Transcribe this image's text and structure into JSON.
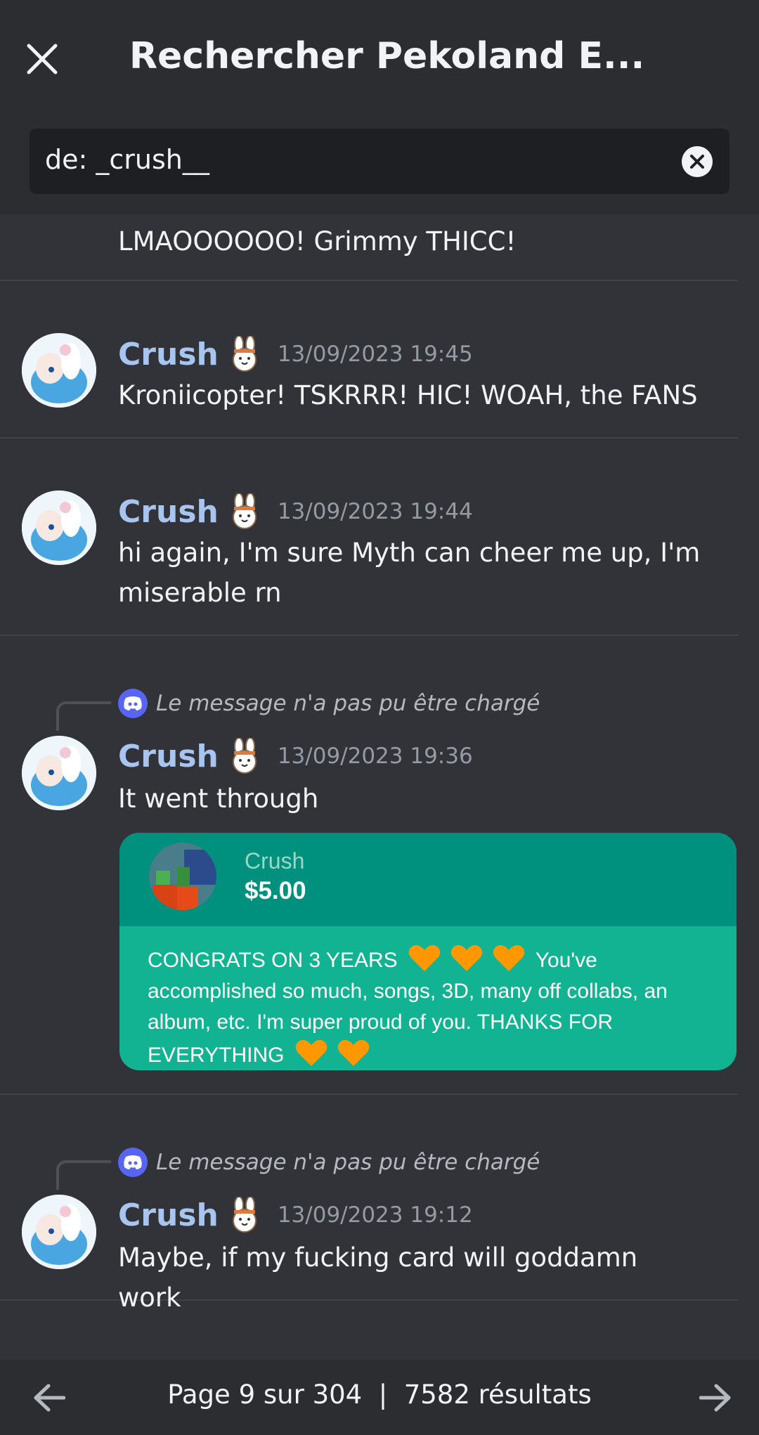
{
  "header": {
    "title": "Rechercher Pekoland E...",
    "search_value": "de: _crush__"
  },
  "results": [
    {
      "name": "",
      "time": "",
      "text": "LMAOOOOOO! Grimmy THICC!"
    },
    {
      "name": "Crush",
      "time": "13/09/2023 19:45",
      "text": "Kroniicopter! TSKRRR! HIC! WOAH, the FANS"
    },
    {
      "name": "Crush",
      "time": "13/09/2023 19:44",
      "text": "hi again, I'm sure Myth can cheer me up, I'm miserable rn"
    },
    {
      "name": "Crush",
      "time": "13/09/2023 19:36",
      "text": "It went through",
      "reply": "Le message n'a pas pu être chargé"
    },
    {
      "name": "Crush",
      "time": "13/09/2023 19:12",
      "text": "Maybe, if my fucking card will goddamn work",
      "reply": "Le message n'a pas pu être chargé"
    }
  ],
  "donation": {
    "name": "Crush",
    "amount": "$5.00",
    "message_part1": "CONGRATS ON 3 YEARS",
    "message_part2": "You've accomplished so much, songs, 3D, many off collabs, an album, etc. I'm super proud of you. THANKS FOR EVERYTHING"
  },
  "footer": {
    "pagination": "Page 9 sur 304  |  7582 résultats"
  },
  "colors": {
    "background": "#313338",
    "header": "#2b2d31",
    "username": "#a8c5f0",
    "donation_top": "#00917e",
    "donation_body": "#12b393",
    "discord_blurple": "#5865f2"
  },
  "icons": [
    "close-icon",
    "clear-icon",
    "bunny-emoji-icon",
    "discord-icon",
    "heart-icon",
    "arrow-left-icon",
    "arrow-right-icon"
  ]
}
